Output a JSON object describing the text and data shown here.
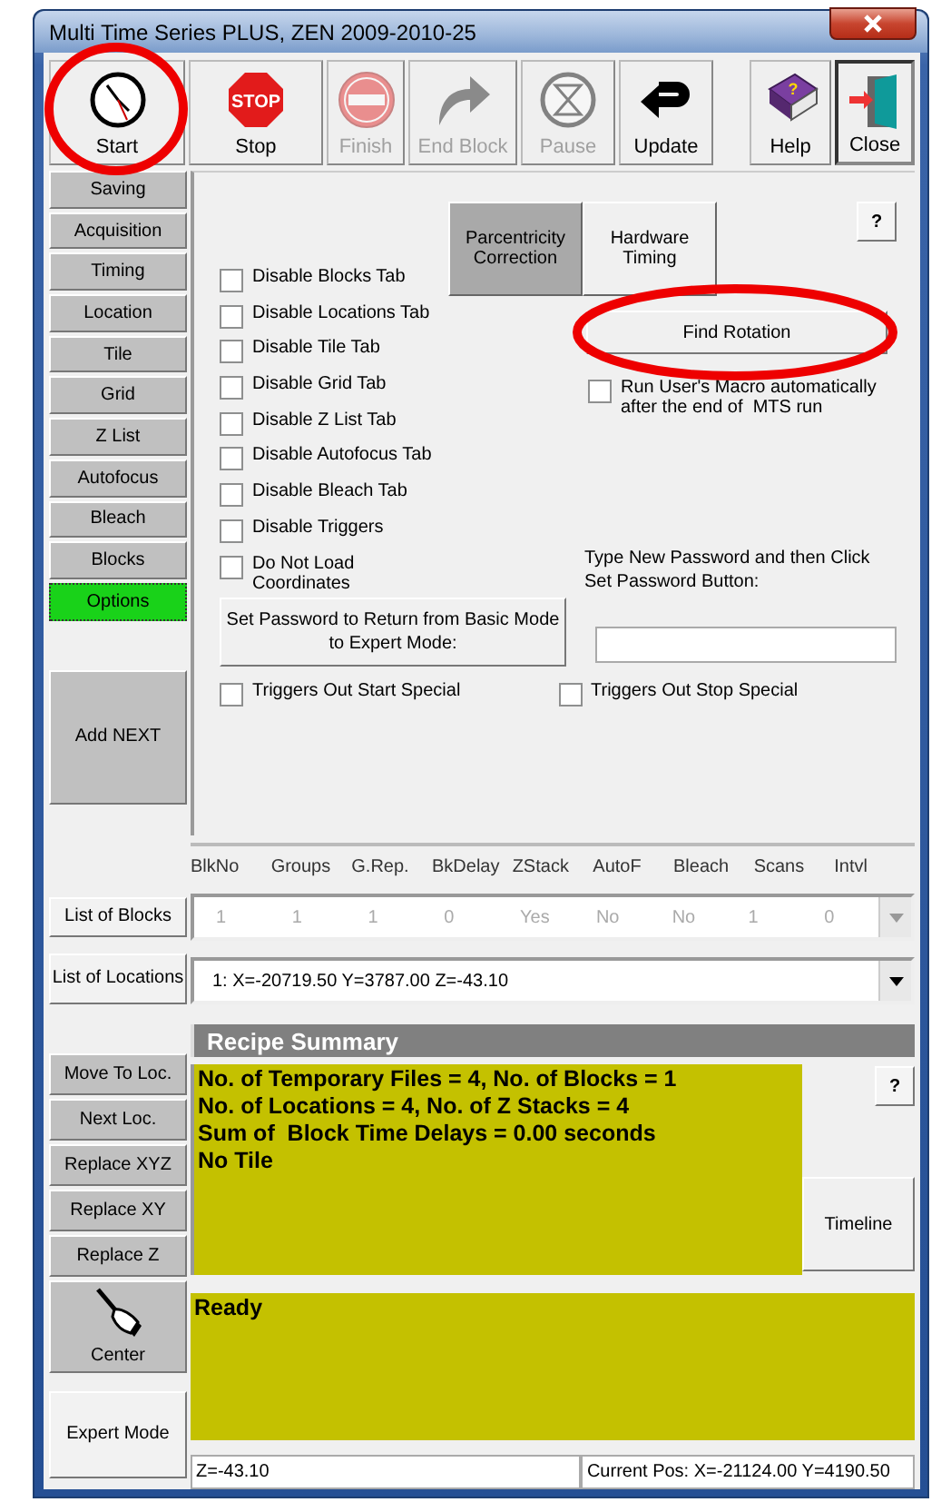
{
  "window": {
    "title": "Multi Time Series PLUS, ZEN 2009-2010-25"
  },
  "toolbar": [
    {
      "label": "Start",
      "kind": "clock",
      "disabled": false,
      "pressed": false,
      "highlighted": true
    },
    {
      "label": "Stop",
      "kind": "stop",
      "icon_text": "STOP",
      "disabled": false,
      "pressed": false,
      "highlighted": false
    },
    {
      "label": "Finish",
      "kind": "noentry",
      "disabled": true,
      "pressed": false,
      "highlighted": false
    },
    {
      "label": "End Block",
      "kind": "curve",
      "disabled": true,
      "pressed": false,
      "highlighted": false
    },
    {
      "label": "Pause",
      "kind": "hourglass",
      "disabled": true,
      "pressed": false,
      "highlighted": false
    },
    {
      "label": "Update",
      "kind": "return",
      "disabled": false,
      "pressed": false,
      "highlighted": false
    },
    {
      "label": "Help",
      "kind": "book",
      "icon_text": "?",
      "disabled": false,
      "pressed": false,
      "highlighted": false
    },
    {
      "label": "Close",
      "kind": "door",
      "disabled": false,
      "pressed": true,
      "highlighted": false
    }
  ],
  "side_tabs": [
    {
      "label": "Saving",
      "selected": false
    },
    {
      "label": "Acquisition",
      "selected": false
    },
    {
      "label": "Timing",
      "selected": false
    },
    {
      "label": "Location",
      "selected": false
    },
    {
      "label": "Tile",
      "selected": false
    },
    {
      "label": "Grid",
      "selected": false
    },
    {
      "label": "Z List",
      "selected": false
    },
    {
      "label": "Autofocus",
      "selected": false
    },
    {
      "label": "Bleach",
      "selected": false
    },
    {
      "label": "Blocks",
      "selected": false
    },
    {
      "label": "Options",
      "selected": true
    }
  ],
  "add_next": "Add NEXT",
  "options": {
    "checkboxes": [
      {
        "label": "Disable Blocks Tab",
        "checked": false
      },
      {
        "label": "Disable Locations Tab",
        "checked": false
      },
      {
        "label": "Disable Tile Tab",
        "checked": false
      },
      {
        "label": "Disable Grid Tab",
        "checked": false
      },
      {
        "label": "Disable Z List Tab",
        "checked": false
      },
      {
        "label": "Disable Autofocus Tab",
        "checked": false
      },
      {
        "label": "Disable Bleach Tab",
        "checked": false
      },
      {
        "label": "Disable Triggers",
        "checked": false
      },
      {
        "label": "Do Not Load Coordinates",
        "checked": false
      }
    ],
    "mode_tabs": [
      {
        "label": "Parcentricity Correction",
        "selected": true
      },
      {
        "label": "Hardware Timing",
        "selected": false
      }
    ],
    "help": "?",
    "find_rotation": {
      "label": "Find Rotation",
      "highlighted": true
    },
    "macro": {
      "label": "Run User's Macro automatically after the end of  MTS run",
      "checked": false
    },
    "password_hint": "Type New Password and then Click Set Password Button:",
    "set_password": "Set Password to Return from Basic Mode to Expert Mode:",
    "triggers": [
      {
        "label": "Triggers Out Start Special",
        "checked": false
      },
      {
        "label": "Triggers Out Stop Special",
        "checked": false
      }
    ]
  },
  "blocks": {
    "button": "List of Blocks",
    "columns": [
      "BlkNo",
      "Groups",
      "G.Rep.",
      "BkDelay",
      "ZStack",
      "AutoF",
      "Bleach",
      "Scans",
      "Intvl"
    ],
    "row": [
      "1",
      "1",
      "1",
      "0",
      "Yes",
      "No",
      "No",
      "1",
      "0"
    ]
  },
  "locations": {
    "button": "List of Locations",
    "value": "1: X=-20719.50 Y=3787.00 Z=-43.10"
  },
  "recipe_summary": {
    "title": "Recipe Summary",
    "lines": [
      "No. of Temporary Files = 4, No. of Blocks = 1",
      "No. of Locations = 4, No. of Z Stacks = 4",
      "Sum of  Block Time Delays = 0.00 seconds",
      "No Tile"
    ],
    "help": "?",
    "timeline": "Timeline"
  },
  "location_buttons": [
    "Move To Loc.",
    "Next Loc.",
    "Replace XYZ",
    "Replace XY",
    "Replace Z"
  ],
  "center": "Center",
  "expert_mode": "Expert Mode",
  "status": "Ready",
  "z_field": "Z=-43.10",
  "position_field": "Current Pos: X=-21124.00 Y=4190.50"
}
